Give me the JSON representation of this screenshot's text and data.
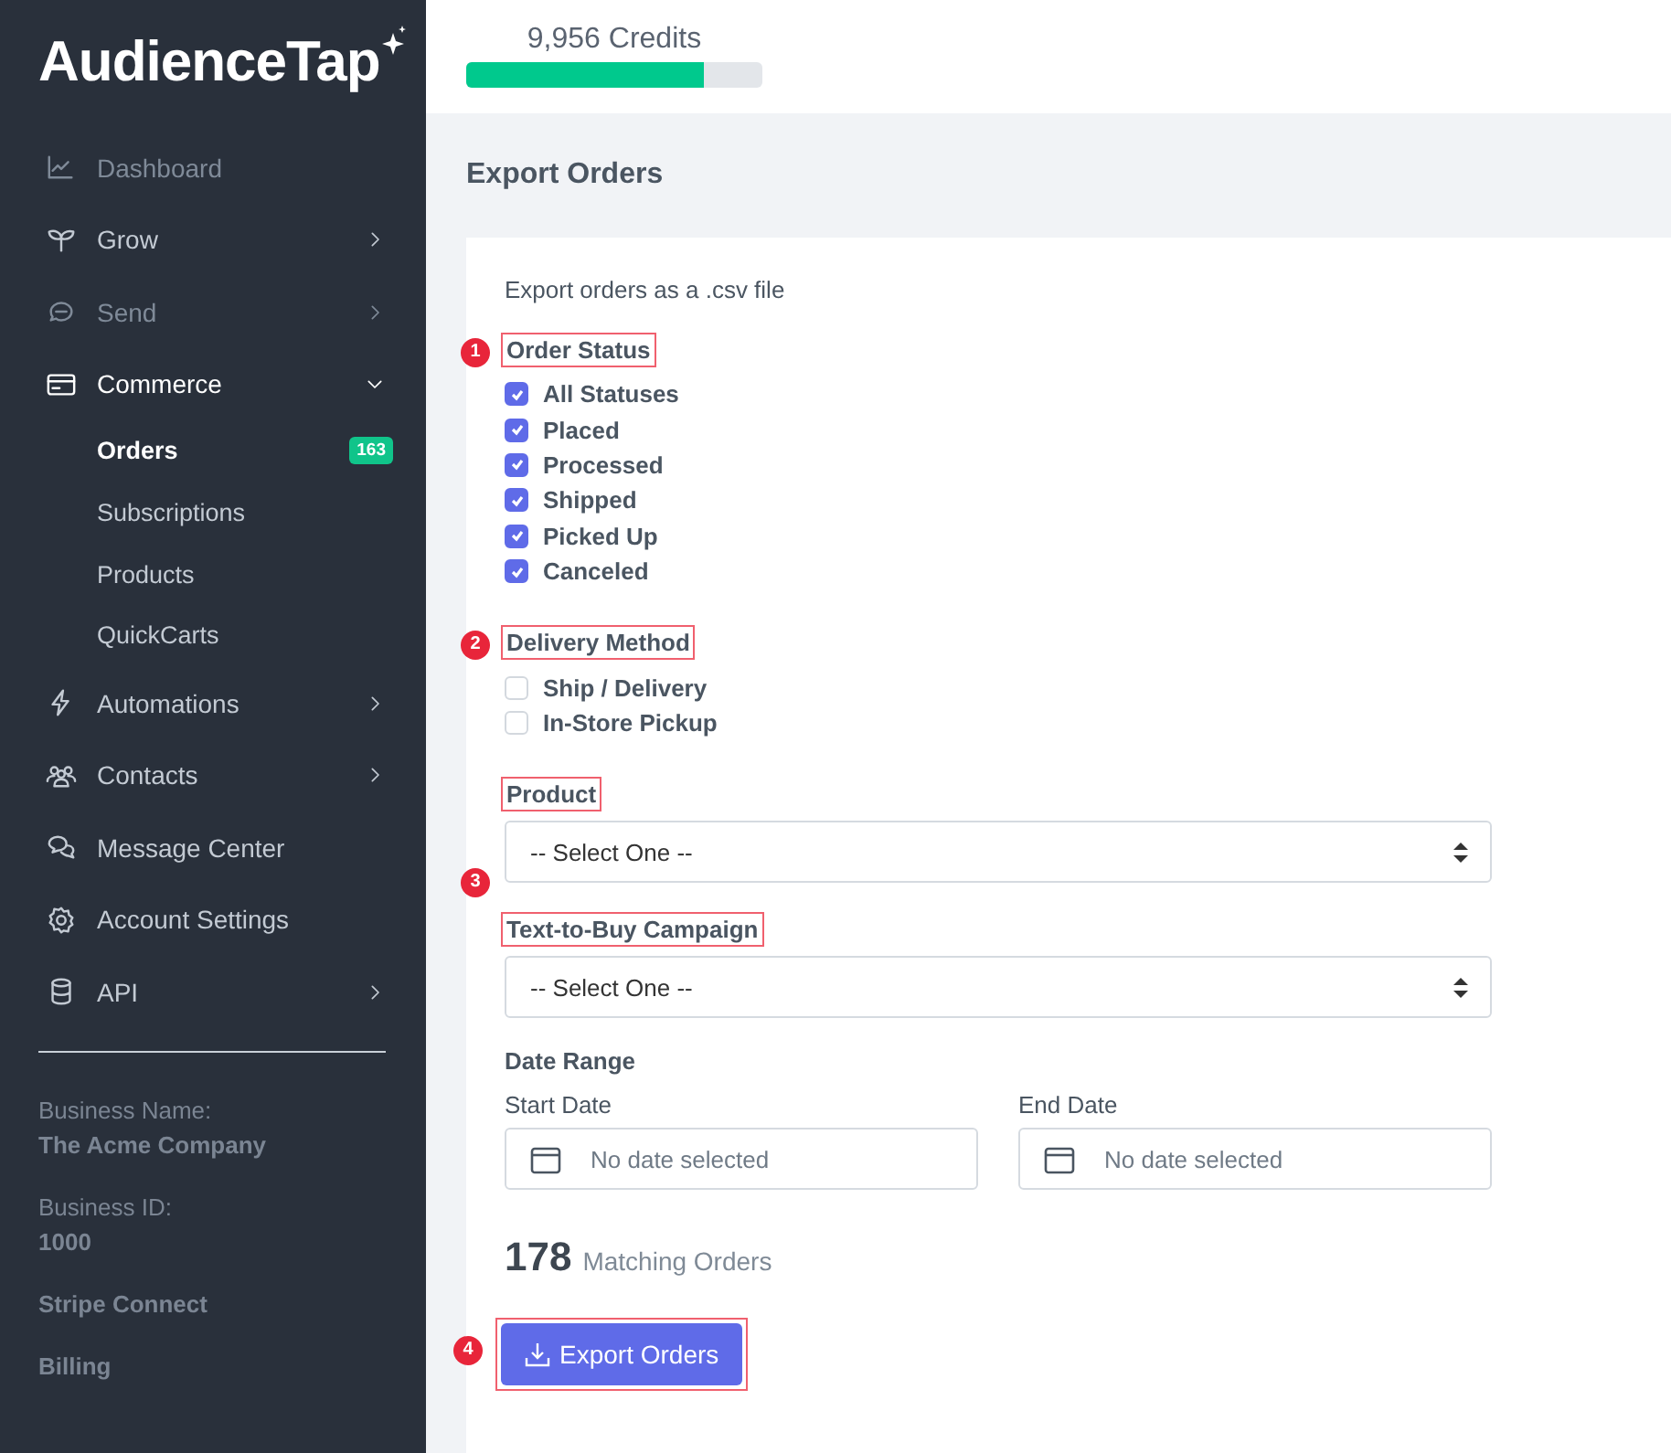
{
  "logo": "AudienceTap",
  "sidebar": {
    "items": [
      {
        "label": "Dashboard",
        "dimmed": true,
        "has_submenu": false,
        "expanded": false
      },
      {
        "label": "Grow",
        "dimmed": false,
        "has_submenu": true,
        "expanded": false
      },
      {
        "label": "Send",
        "dimmed": true,
        "has_submenu": true,
        "expanded": false
      },
      {
        "label": "Commerce",
        "dimmed": false,
        "has_submenu": true,
        "expanded": true,
        "children": [
          {
            "label": "Orders",
            "selected": true,
            "badge": "163"
          },
          {
            "label": "Subscriptions",
            "selected": false
          },
          {
            "label": "Products",
            "selected": false
          },
          {
            "label": "QuickCarts",
            "selected": false
          }
        ]
      },
      {
        "label": "Automations",
        "dimmed": false,
        "has_submenu": true,
        "expanded": false
      },
      {
        "label": "Contacts",
        "dimmed": false,
        "has_submenu": true,
        "expanded": false
      },
      {
        "label": "Message Center",
        "dimmed": false,
        "has_submenu": false,
        "expanded": false
      },
      {
        "label": "Account Settings",
        "dimmed": false,
        "has_submenu": false,
        "expanded": false
      },
      {
        "label": "API",
        "dimmed": false,
        "has_submenu": true,
        "expanded": false
      }
    ],
    "business": [
      {
        "label": "Business Name:",
        "value": "The Acme Company"
      },
      {
        "label": "Business ID:",
        "value": "1000"
      }
    ],
    "links": [
      "Stripe Connect",
      "Billing"
    ]
  },
  "credits": {
    "text": "9,956 Credits",
    "level": 0.8
  },
  "page_title": "Export Orders",
  "form": {
    "intro": "Export orders as a .csv file",
    "order_status": {
      "label": "Order Status",
      "callout": "1",
      "highlighted": true,
      "options": [
        {
          "label": "All Statuses",
          "checked": true
        },
        {
          "label": "Placed",
          "checked": true
        },
        {
          "label": "Processed",
          "checked": true
        },
        {
          "label": "Shipped",
          "checked": true
        },
        {
          "label": "Picked Up",
          "checked": true
        },
        {
          "label": "Canceled",
          "checked": true
        }
      ]
    },
    "delivery_method": {
      "label": "Delivery Method",
      "callout": "2",
      "highlighted": true,
      "options": [
        {
          "label": "Ship / Delivery",
          "checked": false
        },
        {
          "label": "In-Store Pickup",
          "checked": false
        }
      ]
    },
    "product": {
      "label": "Product",
      "highlighted": true,
      "value": "-- Select One --"
    },
    "campaign": {
      "label": "Text-to-Buy Campaign",
      "callout": "3",
      "highlighted": true,
      "value": "-- Select One --"
    },
    "date_range": {
      "label": "Date Range",
      "start": {
        "label": "Start Date",
        "placeholder": "No date selected"
      },
      "end": {
        "label": "End Date",
        "placeholder": "No date selected"
      }
    },
    "matching": {
      "count": "178",
      "label": "Matching Orders"
    },
    "export_button": {
      "label": "Export Orders",
      "callout": "4",
      "highlighted": true
    }
  }
}
